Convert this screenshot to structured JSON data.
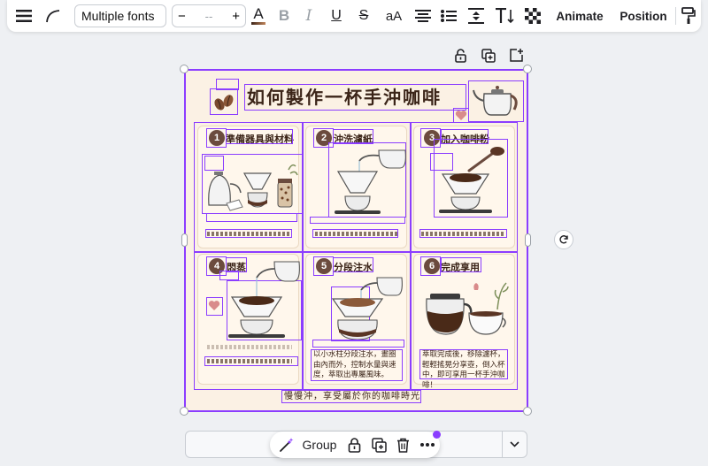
{
  "toolbar": {
    "font_name": "Multiple fonts",
    "font_size_value": "--",
    "decrease_label": "−",
    "increase_label": "+",
    "text_color_letter": "A",
    "bold_letter": "B",
    "italic_letter": "I",
    "underline_letter": "U",
    "strike_letter": "S",
    "case_label": "aA",
    "animate_label": "Animate",
    "position_label": "Position",
    "accent_color": "#8b3dff"
  },
  "design": {
    "title": "如何製作一杯手沖咖啡",
    "footer": "慢慢沖，享受屬於你的咖啡時光",
    "steps": [
      {
        "number": "1",
        "title": "準備器具與材料",
        "description": ""
      },
      {
        "number": "2",
        "title": "沖洗濾紙",
        "description": ""
      },
      {
        "number": "3",
        "title": "加入咖啡粉",
        "description": ""
      },
      {
        "number": "4",
        "title": "悶蒸",
        "description": ""
      },
      {
        "number": "5",
        "title": "分段注水",
        "description": "以小水柱分段注水，畫圈由內而外，控制水量與速度，萃取出專屬風味。"
      },
      {
        "number": "6",
        "title": "完成享用",
        "description": "萃取完成後，移除濾杯，輕輕搖晃分享壺，倒入杯中，即可享用一杯手沖咖啡！"
      }
    ]
  },
  "context_bar": {
    "group_label": "Group"
  }
}
